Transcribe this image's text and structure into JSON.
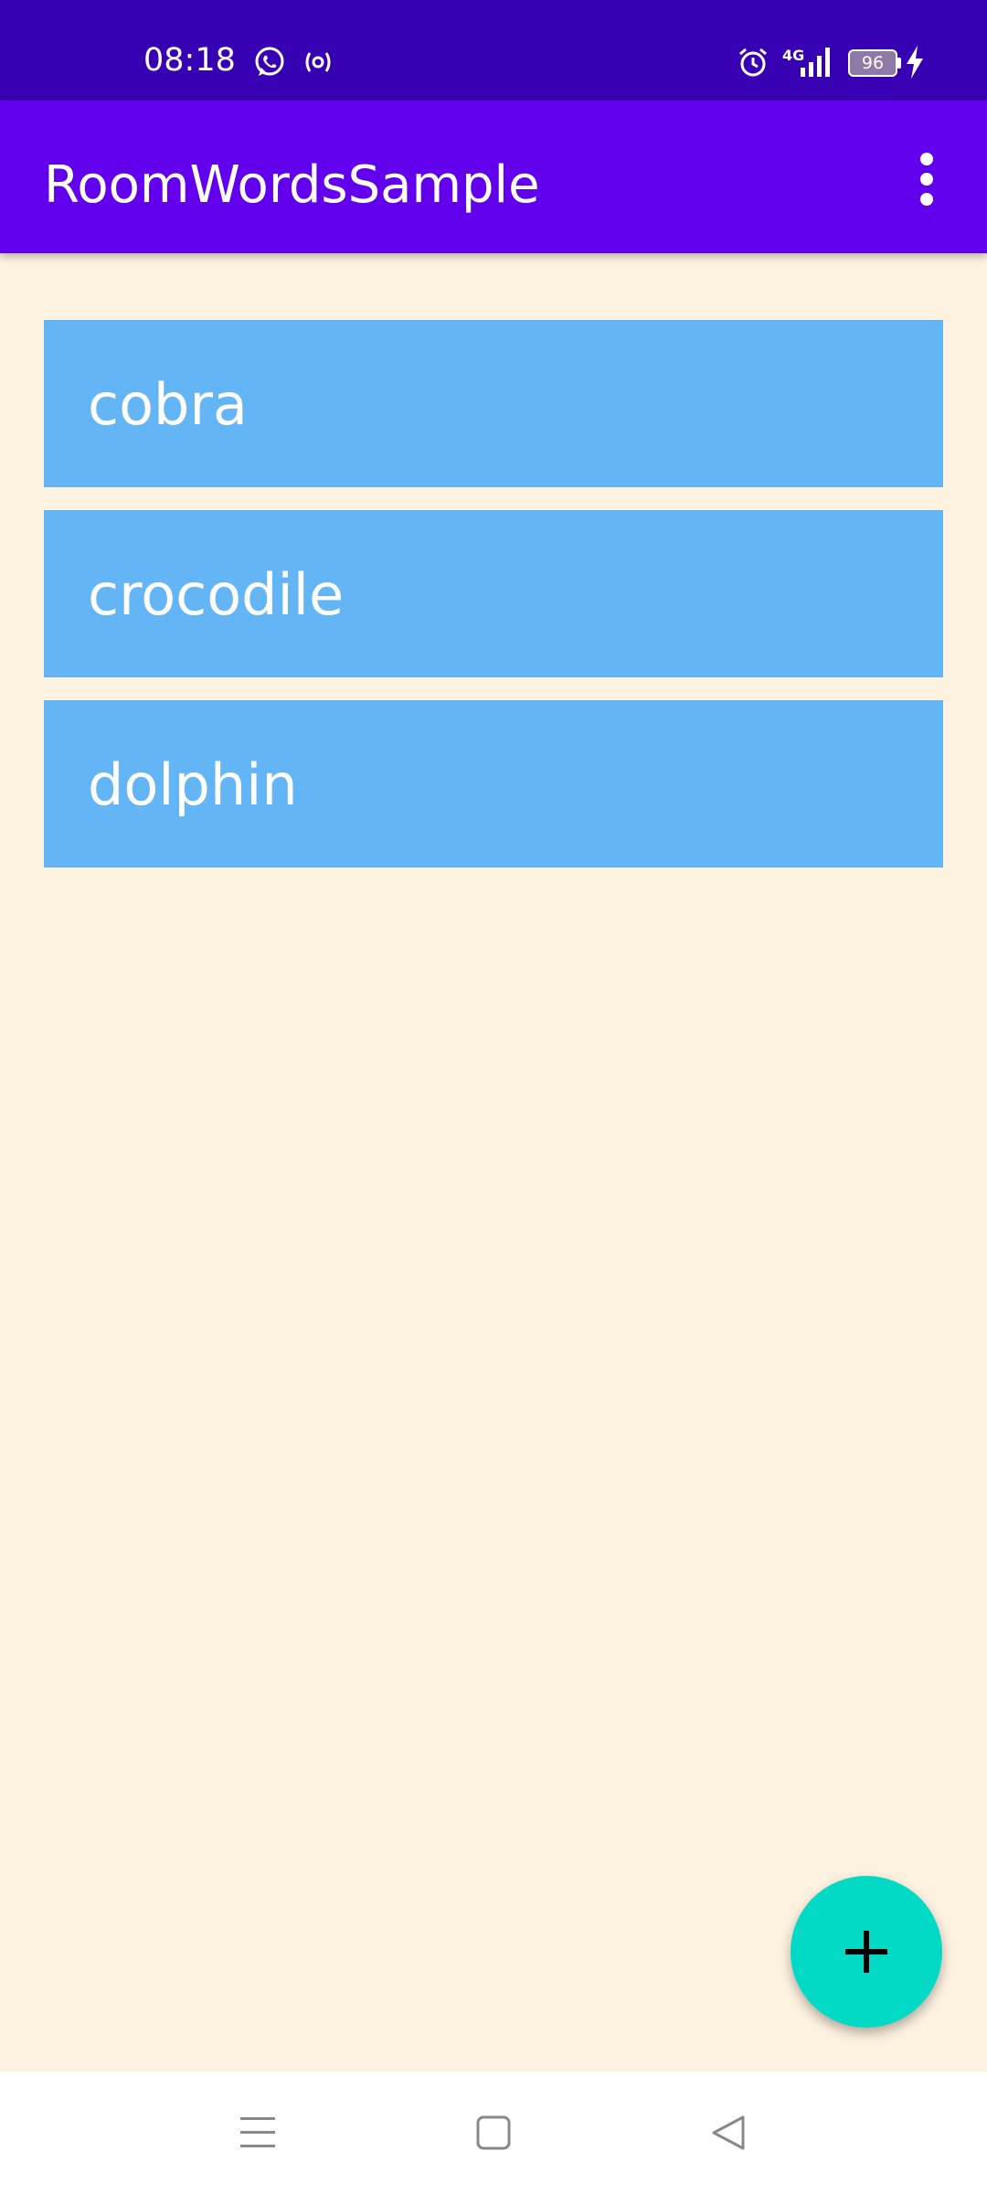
{
  "status_bar": {
    "time": "08:18",
    "battery": "96",
    "network": "4G",
    "icons": [
      "whatsapp-icon",
      "hotspot-icon",
      "alarm-icon",
      "signal-icon",
      "battery-icon",
      "charging-icon"
    ]
  },
  "app_bar": {
    "title": "RoomWordsSample",
    "menu_icon": "more-vert-icon"
  },
  "words": [
    {
      "text": "cobra"
    },
    {
      "text": "crocodile"
    },
    {
      "text": "dolphin"
    }
  ],
  "fab": {
    "icon": "add-icon"
  },
  "nav_bar": {
    "icons": [
      "menu-icon",
      "home-icon",
      "back-icon"
    ]
  },
  "colors": {
    "status_bar": "#3700B3",
    "app_bar": "#6200EE",
    "background": "#FDF1E0",
    "item": "#64B5F6",
    "fab": "#03DAC5"
  }
}
